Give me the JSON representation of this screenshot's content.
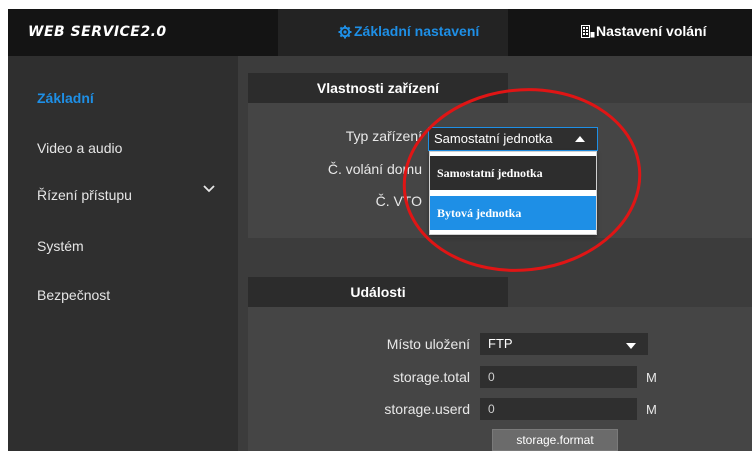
{
  "header": {
    "brand": "WEB SERVICE2.0",
    "tab_basic": "Základní nastavení",
    "tab_call": "Nastavení volání"
  },
  "sidebar": {
    "items": [
      {
        "label": "Základní",
        "active": true
      },
      {
        "label": "Video a audio"
      },
      {
        "label": "Řízení přístupu",
        "expandable": true
      },
      {
        "label": "Systém"
      },
      {
        "label": "Bezpečnost"
      }
    ]
  },
  "device_panel": {
    "title": "Vlastnosti zařízení",
    "type_label": "Typ zařízení",
    "type_value": "Samostatní jednotka",
    "call_number_label": "Č. volání domu",
    "vto_label": "Č. VTO",
    "dropdown_options": [
      "Samostatní jednotka",
      "Bytová jednotka"
    ]
  },
  "events_panel": {
    "title": "Události",
    "storage_location_label": "Místo uložení",
    "storage_location_value": "FTP",
    "storage_total_label": "storage.total",
    "storage_total_value": "0",
    "storage_total_unit": "M",
    "storage_userd_label": "storage.userd",
    "storage_userd_value": "0",
    "storage_userd_unit": "M",
    "format_button": "storage.format"
  },
  "colors": {
    "accent": "#1e8fe6",
    "annotation": "#e01515"
  },
  "icons": {
    "tab_basic": "gear-icon",
    "tab_call": "building-icon",
    "expand": "chevron-down-icon"
  }
}
